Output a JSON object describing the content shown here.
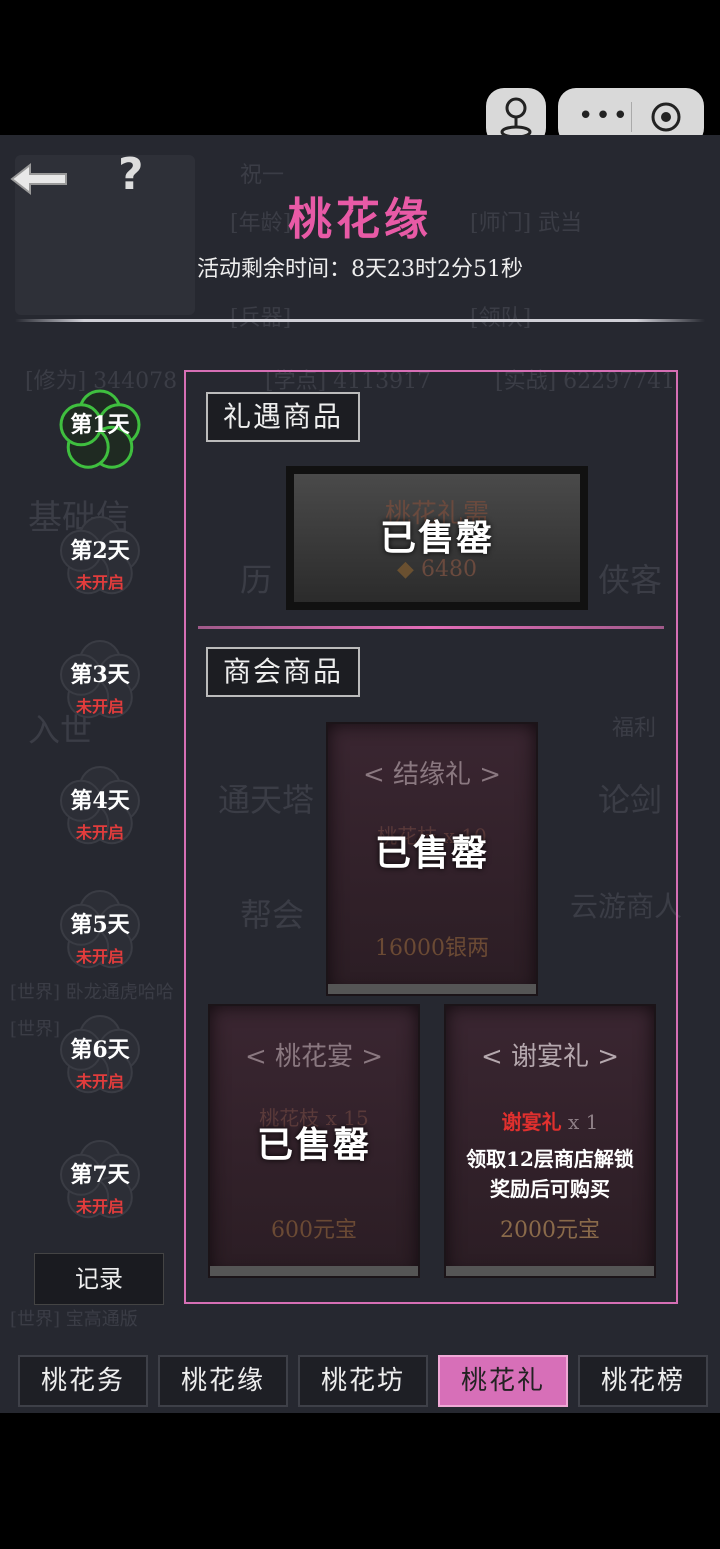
{
  "header": {
    "title": "桃花缘",
    "timer": "活动剩余时间：8天23时2分51秒",
    "back_icon": "back-arrow-icon",
    "help_icon": "question-icon",
    "help_glyph": "?"
  },
  "capsule": {
    "more_icon": "more-dots-icon",
    "close_icon": "target-circle-icon",
    "avatar_icon": "mini-program-icon",
    "more_glyph": "•••"
  },
  "days": [
    {
      "label": "第1天",
      "status": ""
    },
    {
      "label": "第2天",
      "status": "未开启"
    },
    {
      "label": "第3天",
      "status": "未开启"
    },
    {
      "label": "第4天",
      "status": "未开启"
    },
    {
      "label": "第5天",
      "status": "未开启"
    },
    {
      "label": "第6天",
      "status": "未开启"
    },
    {
      "label": "第7天",
      "status": "未开启"
    }
  ],
  "record_label": "记录",
  "section1": {
    "title": "礼遇商品",
    "item": {
      "name": "桃花礼需",
      "price": "6480",
      "sold": "已售罄"
    }
  },
  "section2": {
    "title": "商会商品",
    "items": [
      {
        "name": "< 结缘礼 >",
        "qty": "桃花枝 x 10",
        "price": "16000银两",
        "sold": "已售罄"
      },
      {
        "name": "< 桃花宴 >",
        "qty": "桃花枝 x 15",
        "price": "600元宝",
        "sold": "已售罄"
      },
      {
        "name": "< 谢宴礼 >",
        "qty_name": "谢宴礼",
        "qty_count": "x 1",
        "lock_text_1": "领取12层商店解锁",
        "lock_text_2": "奖励后可购买",
        "price": "2000元宝"
      }
    ]
  },
  "tabs": [
    {
      "label": "桃花务",
      "active": false
    },
    {
      "label": "桃花缘",
      "active": false
    },
    {
      "label": "桃花坊",
      "active": false
    },
    {
      "label": "桃花礼",
      "active": true
    },
    {
      "label": "桃花榜",
      "active": false
    }
  ],
  "background_text": {
    "t1": "祝一",
    "t2": "[年龄]",
    "t3": "[师门]  武当",
    "t4": "[兵器]",
    "t5": "[领队]",
    "t6": "[修为] 344078",
    "t7": "[学点] 4113917",
    "t8": "[实战] 62297741",
    "t9": "基础信",
    "t10": "历",
    "t11": "侠客",
    "t12": "入世",
    "t13": "福利",
    "t14": "通天塔",
    "t15": "论剑",
    "t16": "帮会",
    "t17": "云游商人",
    "t18": "[世界] 卧龙通虎哈哈",
    "t19": "[世界]",
    "t20": "[世界] 宝高通版"
  },
  "colors": {
    "accent": "#e85aa6",
    "panel": "#262830",
    "status_red": "#e23c3c",
    "lock_red": "#e0302e"
  }
}
